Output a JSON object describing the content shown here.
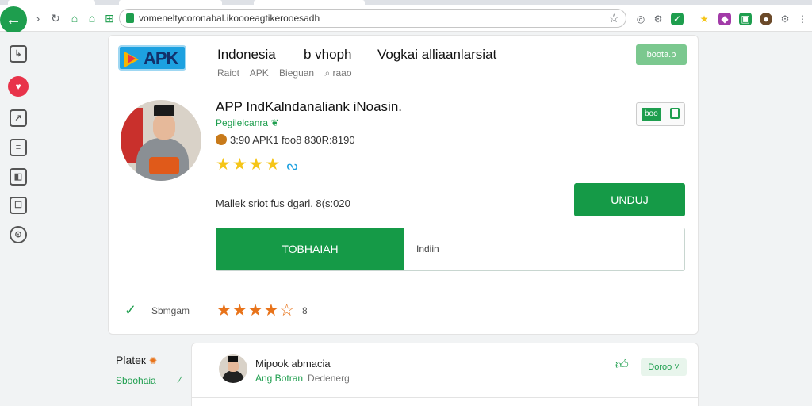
{
  "browser": {
    "url": "vomeneltycoronabal.ikoooeagtikerooesadh",
    "back_glyph": "←",
    "icons": [
      "reload-icon",
      "home-icon",
      "shop-icon",
      "extension-icon",
      "star-icon"
    ]
  },
  "rail": {
    "items": [
      "↳",
      "♥",
      "↗",
      "≡",
      "◧",
      "☐",
      "⊙"
    ]
  },
  "header": {
    "logo_text": "APK",
    "title_a": "Indonesia",
    "title_b": "b vhoph",
    "title_c": "Vogkai alliaanlarsiat",
    "crumbs": [
      "Raiot",
      "APK",
      "Bieguan"
    ],
    "search_label": "raao",
    "badge": "boota.b"
  },
  "app": {
    "title": "APP IndKalndanaliank iNoasin.",
    "developer": "Pegilelcanra",
    "meta": "3:90 APK1 foo8 830R:8190",
    "stars": "★★★★",
    "desc": "Mallek sriot fus dgarl. 8(s:020",
    "download_label": "UNDUJ",
    "badge_label": "boo",
    "split_left": "TOBHAIAH",
    "split_right": "Indiin"
  },
  "rating": {
    "label": "Sbmgam",
    "stars": "★★★★☆",
    "count": "8"
  },
  "bottom": {
    "left_title": "Plateк",
    "left_sub": "Sboohaia",
    "left_arrow": "∕",
    "name": "Mipook abmacia",
    "sub": "Ang Botran",
    "sub2": "Dedenerg",
    "pill": "Doroo ˅"
  },
  "colors": {
    "brand_green": "#159a47",
    "accent_red": "#e8334a",
    "star_yellow": "#f5c518",
    "star_orange": "#e8731a"
  }
}
